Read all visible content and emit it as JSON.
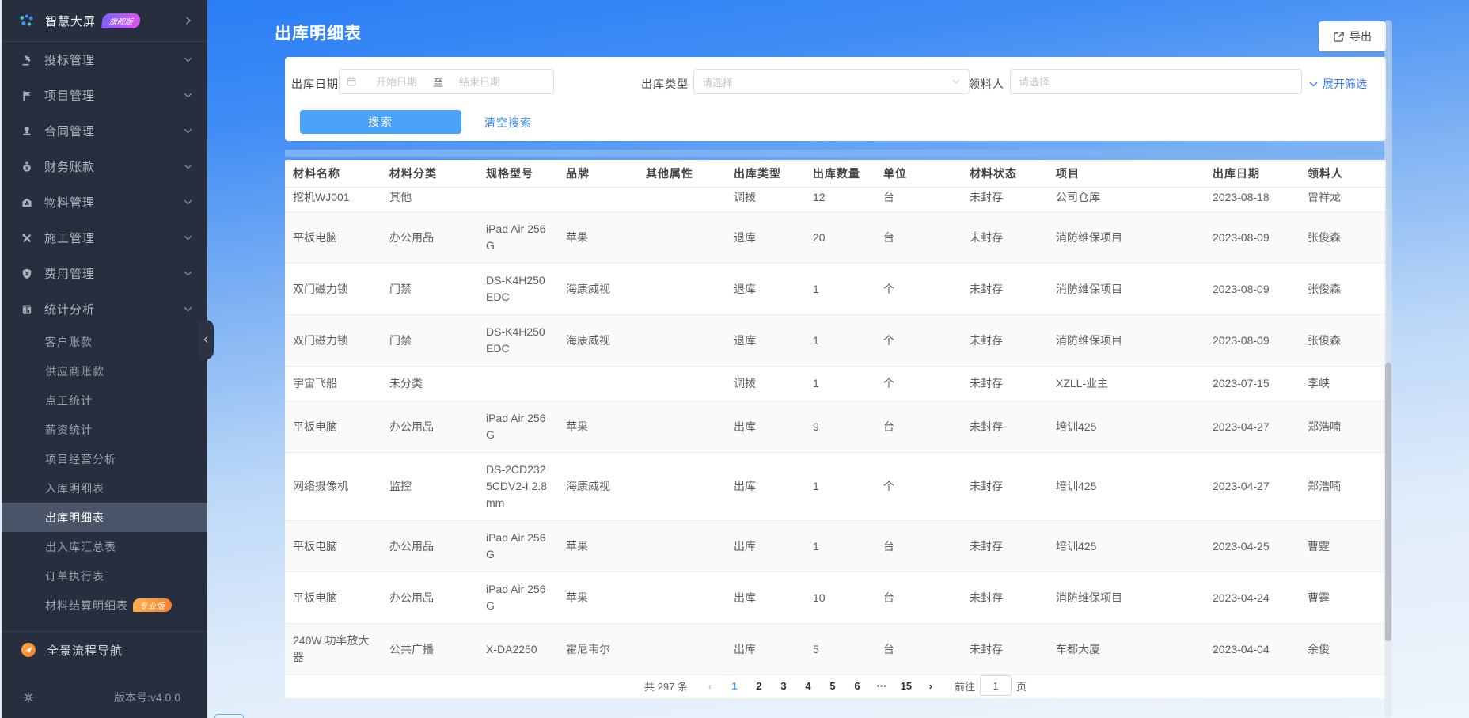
{
  "sidebar": {
    "logo": {
      "title": "智慧大屏",
      "badge": "旗舰版"
    },
    "menu": [
      {
        "label": "投标管理",
        "icon": "gavel-icon"
      },
      {
        "label": "项目管理",
        "icon": "project-flag-icon"
      },
      {
        "label": "合同管理",
        "icon": "stamp-icon"
      },
      {
        "label": "财务账款",
        "icon": "money-bag-icon"
      },
      {
        "label": "物料管理",
        "icon": "warehouse-icon"
      },
      {
        "label": "施工管理",
        "icon": "tools-icon"
      },
      {
        "label": "费用管理",
        "icon": "shield-icon"
      },
      {
        "label": "统计分析",
        "icon": "stats-icon",
        "expanded": true
      }
    ],
    "submenu": [
      {
        "label": "客户账款"
      },
      {
        "label": "供应商账款"
      },
      {
        "label": "点工统计"
      },
      {
        "label": "薪资统计"
      },
      {
        "label": "项目经营分析"
      },
      {
        "label": "入库明细表"
      },
      {
        "label": "出库明细表",
        "active": true
      },
      {
        "label": "出入库汇总表"
      },
      {
        "label": "订单执行表"
      },
      {
        "label": "材料结算明细表",
        "badge": "专业版"
      }
    ],
    "footer_nav": "全景流程导航",
    "version": "版本号:v4.0.0"
  },
  "page": {
    "title": "出库明细表",
    "export_label": "导出"
  },
  "filters": {
    "date_label": "出库日期",
    "date_start_placeholder": "开始日期",
    "date_separator": "至",
    "date_end_placeholder": "结束日期",
    "type_label": "出库类型",
    "type_placeholder": "请选择",
    "picker_label": "领料人",
    "picker_placeholder": "请选择",
    "expand_label": "展开筛选",
    "search_label": "搜索",
    "clear_label": "清空搜索"
  },
  "table": {
    "columns": [
      "材料名称",
      "材料分类",
      "规格型号",
      "品牌",
      "其他属性",
      "出库类型",
      "出库数量",
      "单位",
      "材料状态",
      "项目",
      "出库日期",
      "领料人"
    ],
    "rows": [
      [
        "挖机WJ001",
        "其他",
        "",
        "",
        "",
        "调拨",
        "12",
        "台",
        "未封存",
        "公司仓库",
        "2023-08-18",
        "曾祥龙"
      ],
      [
        "平板电脑",
        "办公用品",
        "iPad Air 256 G",
        "苹果",
        "",
        "退库",
        "20",
        "台",
        "未封存",
        "消防维保项目",
        "2023-08-09",
        "张俊森"
      ],
      [
        "双门磁力锁",
        "门禁",
        "DS-K4H250 EDC",
        "海康威视",
        "",
        "退库",
        "1",
        "个",
        "未封存",
        "消防维保项目",
        "2023-08-09",
        "张俊森"
      ],
      [
        "双门磁力锁",
        "门禁",
        "DS-K4H250 EDC",
        "海康威视",
        "",
        "退库",
        "1",
        "个",
        "未封存",
        "消防维保项目",
        "2023-08-09",
        "张俊森"
      ],
      [
        "宇宙飞船",
        "未分类",
        "",
        "",
        "",
        "调拨",
        "1",
        "个",
        "未封存",
        "XZLL-业主",
        "2023-07-15",
        "李峡"
      ],
      [
        "平板电脑",
        "办公用品",
        "iPad Air 256 G",
        "苹果",
        "",
        "出库",
        "9",
        "台",
        "未封存",
        "培训425",
        "2023-04-27",
        "郑浩喃"
      ],
      [
        "网络摄像机",
        "监控",
        "DS-2CD232 5CDV2-I 2.8 mm",
        "海康威视",
        "",
        "出库",
        "1",
        "个",
        "未封存",
        "培训425",
        "2023-04-27",
        "郑浩喃"
      ],
      [
        "平板电脑",
        "办公用品",
        "iPad Air 256 G",
        "苹果",
        "",
        "出库",
        "1",
        "台",
        "未封存",
        "培训425",
        "2023-04-25",
        "曹霆"
      ],
      [
        "平板电脑",
        "办公用品",
        "iPad Air 256 G",
        "苹果",
        "",
        "出库",
        "10",
        "台",
        "未封存",
        "消防维保项目",
        "2023-04-24",
        "曹霆"
      ],
      [
        "240W 功率放大器",
        "公共广播",
        "X-DA2250",
        "霍尼韦尔",
        "",
        "出库",
        "5",
        "台",
        "未封存",
        "车都大厦",
        "2023-04-04",
        "余俊"
      ]
    ]
  },
  "pagination": {
    "total": "共 297 条",
    "pages": [
      "1",
      "2",
      "3",
      "4",
      "5",
      "6",
      "···",
      "15"
    ],
    "current": "1",
    "goto_prefix": "前往",
    "goto_value": "1",
    "goto_suffix": "页"
  },
  "colors": {
    "accent": "#409eff",
    "sidebar_bg": "#272e3d",
    "sidebar_active_bg": "#4b5569",
    "header_blue": "#2a7ef5",
    "table_top_strip": "#7cb0f1",
    "search_button": "#4aa1f8",
    "link_blue": "#3a7bf6",
    "flagship_badge": "#e052f0",
    "pro_badge": "#f57f2c",
    "compass_orange": "#f2762a"
  }
}
